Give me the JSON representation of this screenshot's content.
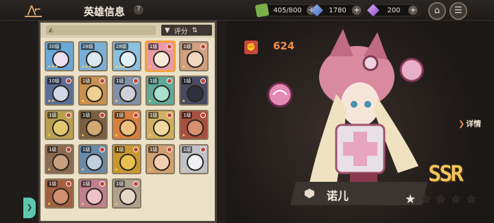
{
  "header": {
    "title": "英雄信息",
    "help_label": "?"
  },
  "resources": [
    {
      "icon": "stamina-icon",
      "value": "405/800",
      "plus": "+"
    },
    {
      "icon": "blue-crystal-icon",
      "value": "1780",
      "plus": "+"
    },
    {
      "icon": "purple-crystal-icon",
      "value": "200",
      "plus": "+"
    }
  ],
  "nav": {
    "home_icon": "home-icon",
    "menu_icon": "menu-icon"
  },
  "list": {
    "sort_label": "评分",
    "heroes": [
      {
        "level": "30级",
        "color": "#6aa8d8",
        "badge": false,
        "stars": "★★★",
        "face": "#e8e0f0"
      },
      {
        "level": "28级",
        "color": "#7ab0d8",
        "badge": false,
        "stars": "★★★",
        "face": "#d8e8f0"
      },
      {
        "level": "28级",
        "color": "#8ac0e0",
        "badge": false,
        "stars": "★★★",
        "face": "#e0f0f8"
      },
      {
        "level": "1级",
        "color": "#e89aa8",
        "badge": true,
        "stars": "★",
        "face": "#f8e8d8",
        "selected": true
      },
      {
        "level": "1级",
        "color": "#d0a080",
        "badge": true,
        "stars": "★",
        "face": "#f0d8c0"
      },
      {
        "level": "10级",
        "color": "#5a6e98",
        "badge": true,
        "stars": "★★",
        "face": "#d0d8e8"
      },
      {
        "level": "1级",
        "color": "#c89050",
        "badge": true,
        "stars": "★",
        "face": "#f0d090"
      },
      {
        "level": "1级",
        "color": "#8090a8",
        "badge": true,
        "stars": "★",
        "face": "#d0d0d8"
      },
      {
        "level": "1级",
        "color": "#60a898",
        "badge": true,
        "stars": "★",
        "face": "#a8e0d0"
      },
      {
        "level": "1级",
        "color": "#4a4a60",
        "badge": true,
        "stars": "★",
        "face": "#303040"
      },
      {
        "level": "1级",
        "color": "#b8a050",
        "badge": true,
        "stars": "★",
        "face": "#e0c870"
      },
      {
        "level": "1级",
        "color": "#7a6040",
        "badge": true,
        "stars": "★",
        "face": "#d0a870"
      },
      {
        "level": "1级",
        "color": "#d88040",
        "badge": true,
        "stars": "★",
        "face": "#f0c080"
      },
      {
        "level": "1级",
        "color": "#d0b060",
        "badge": true,
        "stars": "★",
        "face": "#f0d8a0"
      },
      {
        "level": "1级",
        "color": "#a85040",
        "badge": true,
        "stars": "★",
        "face": "#d89070"
      },
      {
        "level": "1级",
        "color": "#8a6a50",
        "badge": true,
        "stars": "★",
        "face": "#c8a080"
      },
      {
        "level": "1级",
        "color": "#6a8aa8",
        "badge": true,
        "stars": "★",
        "face": "#c0d0e0"
      },
      {
        "level": "1级",
        "color": "#c89830",
        "badge": true,
        "stars": "★",
        "face": "#e8c050"
      },
      {
        "level": "1级",
        "color": "#d0a070",
        "badge": true,
        "stars": "★",
        "face": "#f0d0b0"
      },
      {
        "level": "1级",
        "color": "#c0c0c8",
        "badge": true,
        "stars": "★",
        "face": "#f0f0f4"
      },
      {
        "level": "1级",
        "color": "#a06040",
        "badge": true,
        "stars": "★",
        "face": "#d09070"
      },
      {
        "level": "1级",
        "color": "#c08090",
        "badge": true,
        "stars": "★",
        "face": "#f0c0c8"
      },
      {
        "level": "1级",
        "color": "#b0a090",
        "badge": true,
        "stars": "★",
        "face": "#e8d8c8"
      }
    ]
  },
  "side_button": {
    "label": "❯"
  },
  "showcase": {
    "power_icon": "fist-icon",
    "power": "624",
    "detail_label": "详情",
    "rarity": "SSR",
    "hero_name": "诺儿",
    "star_count": 1,
    "star_total": 5
  },
  "colors": {
    "accent": "#f08c4e",
    "panel_bg": "#ebe1c9",
    "selected_border": "#f2a23c",
    "rarity_gold": "#f2c45a"
  }
}
